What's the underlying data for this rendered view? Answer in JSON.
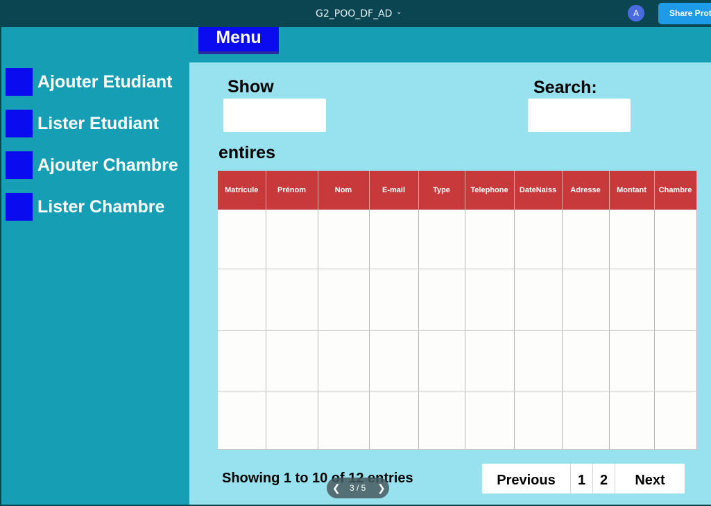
{
  "topbar": {
    "project_title": "G2_POO_DF_AD",
    "caret": "ˇ",
    "avatar_letter": "A",
    "share_label": "Share Prototype"
  },
  "menu": {
    "label": "Menu"
  },
  "sidebar": {
    "items": [
      {
        "label": "Ajouter Etudiant"
      },
      {
        "label": "Lister Etudiant"
      },
      {
        "label": "Ajouter Chambre"
      },
      {
        "label": "Lister Chambre"
      }
    ]
  },
  "main": {
    "show_label": "Show",
    "search_label": "Search:",
    "entries_label": "entires",
    "table": {
      "columns": [
        "Matricule",
        "Prénom",
        "Nom",
        "E-mail",
        "Type",
        "Telephone",
        "DateNaiss",
        "Adresse",
        "Montant",
        "Chambre"
      ],
      "empty_rows": 4
    },
    "showing_text": "Showing 1 to 10 of 12 entries",
    "pagination": {
      "previous": "Previous",
      "pages": [
        "1",
        "2"
      ],
      "next": "Next"
    }
  },
  "slide_nav": {
    "counter": "3 / 5",
    "prev_icon": "chevron-left-icon",
    "next_icon": "chevron-right-icon"
  },
  "colors": {
    "topbar": "#0b4551",
    "sidebar": "#169fb4",
    "content": "#98e2ef",
    "accent_blue": "#0b0bf0",
    "table_header": "#c7393a",
    "share_button": "#1e9be8"
  }
}
